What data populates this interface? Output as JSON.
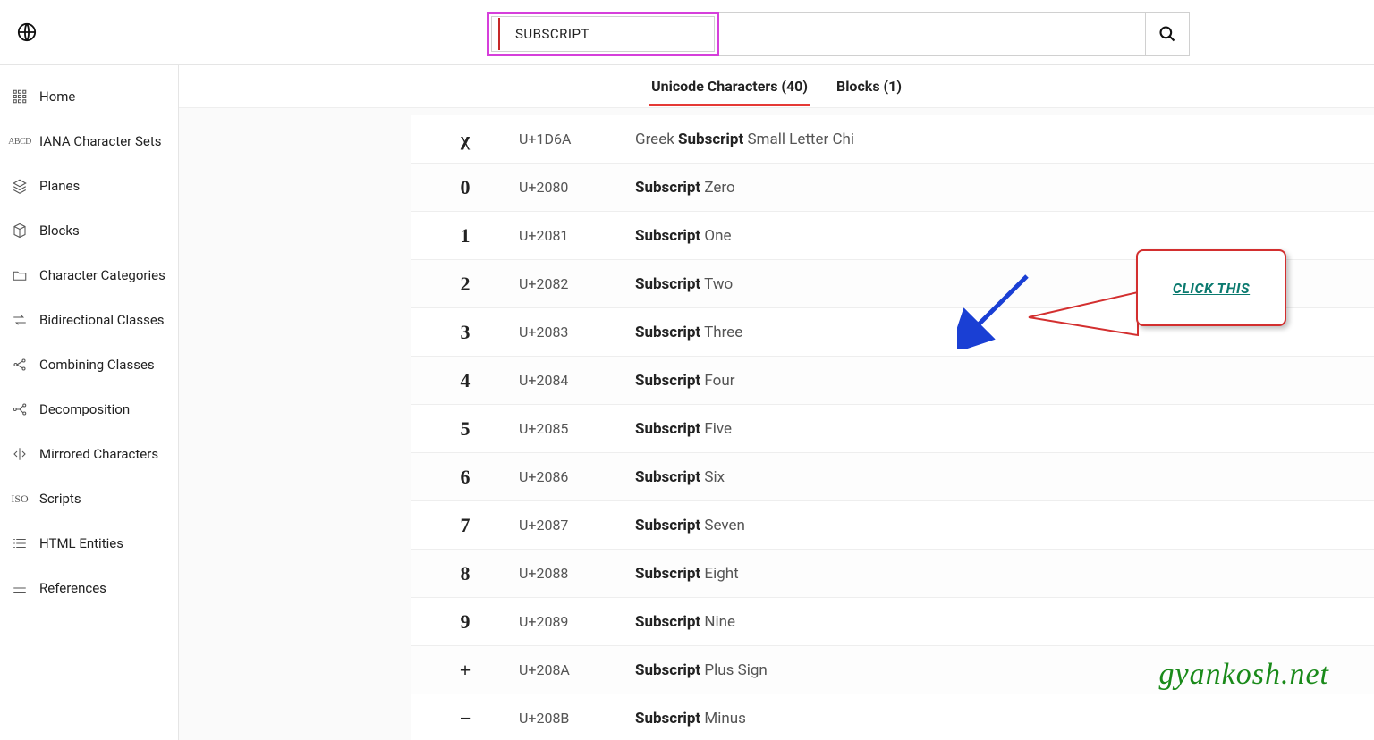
{
  "search": {
    "value": "SUBSCRIPT"
  },
  "sidebar": {
    "items": [
      {
        "label": "Home"
      },
      {
        "label": "IANA Character Sets"
      },
      {
        "label": "Planes"
      },
      {
        "label": "Blocks"
      },
      {
        "label": "Character Categories"
      },
      {
        "label": "Bidirectional Classes"
      },
      {
        "label": "Combining Classes"
      },
      {
        "label": "Decomposition"
      },
      {
        "label": "Mirrored Characters"
      },
      {
        "label": "Scripts"
      },
      {
        "label": "HTML Entities"
      },
      {
        "label": "References"
      }
    ]
  },
  "tabs": {
    "characters_label": "Unicode Characters (40)",
    "blocks_label": "Blocks (1)"
  },
  "results": [
    {
      "glyph": "χ",
      "code": "U+1D6A",
      "name_prefix": "Greek ",
      "name_bold": "Subscript",
      "name_suffix": " Small Letter Chi"
    },
    {
      "glyph": "0",
      "code": "U+2080",
      "name_prefix": "",
      "name_bold": "Subscript",
      "name_suffix": " Zero"
    },
    {
      "glyph": "1",
      "code": "U+2081",
      "name_prefix": "",
      "name_bold": "Subscript",
      "name_suffix": " One"
    },
    {
      "glyph": "2",
      "code": "U+2082",
      "name_prefix": "",
      "name_bold": "Subscript",
      "name_suffix": " Two"
    },
    {
      "glyph": "3",
      "code": "U+2083",
      "name_prefix": "",
      "name_bold": "Subscript",
      "name_suffix": " Three"
    },
    {
      "glyph": "4",
      "code": "U+2084",
      "name_prefix": "",
      "name_bold": "Subscript",
      "name_suffix": " Four"
    },
    {
      "glyph": "5",
      "code": "U+2085",
      "name_prefix": "",
      "name_bold": "Subscript",
      "name_suffix": " Five"
    },
    {
      "glyph": "6",
      "code": "U+2086",
      "name_prefix": "",
      "name_bold": "Subscript",
      "name_suffix": " Six"
    },
    {
      "glyph": "7",
      "code": "U+2087",
      "name_prefix": "",
      "name_bold": "Subscript",
      "name_suffix": " Seven"
    },
    {
      "glyph": "8",
      "code": "U+2088",
      "name_prefix": "",
      "name_bold": "Subscript",
      "name_suffix": " Eight"
    },
    {
      "glyph": "9",
      "code": "U+2089",
      "name_prefix": "",
      "name_bold": "Subscript",
      "name_suffix": " Nine"
    },
    {
      "glyph": "+",
      "code": "U+208A",
      "name_prefix": "",
      "name_bold": "Subscript",
      "name_suffix": " Plus Sign"
    },
    {
      "glyph": "−",
      "code": "U+208B",
      "name_prefix": "",
      "name_bold": "Subscript",
      "name_suffix": " Minus"
    }
  ],
  "callout": {
    "text": "CLICK THIS"
  },
  "watermark": "gyankosh.net"
}
